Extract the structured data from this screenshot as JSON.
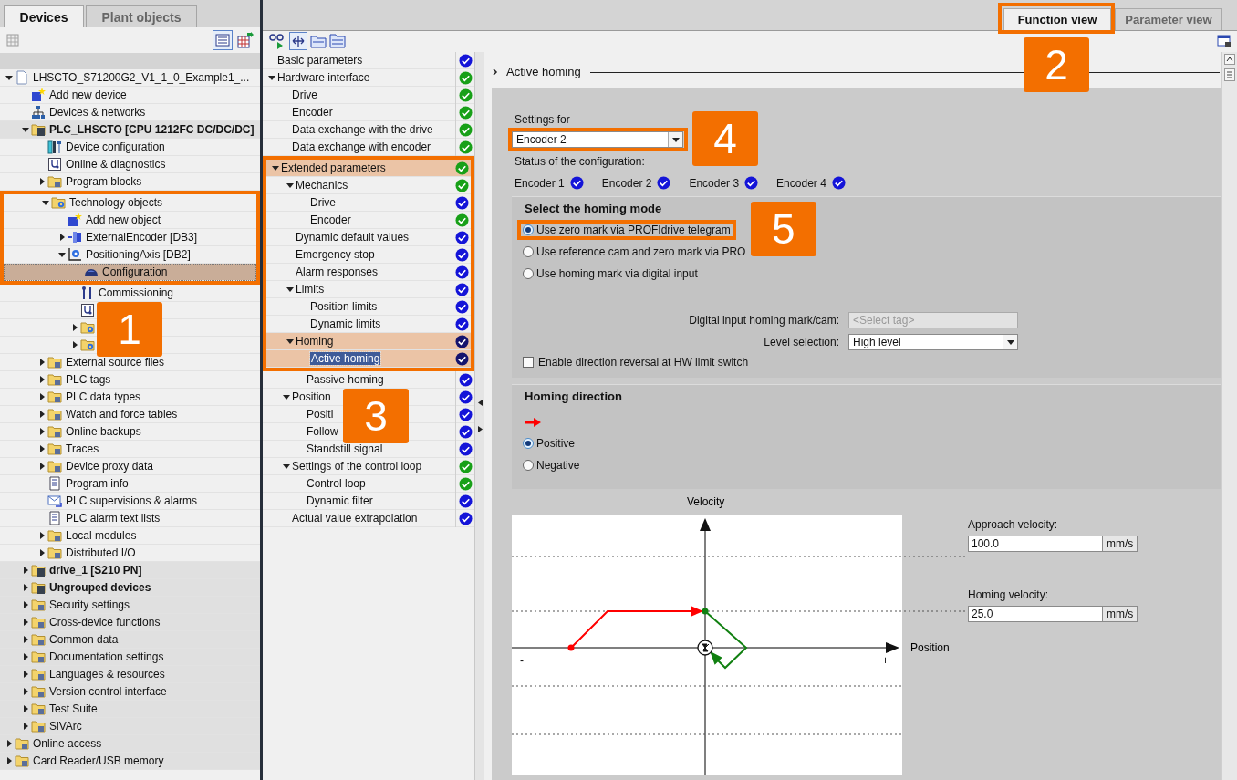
{
  "project_tree": {
    "tabs": [
      {
        "label": "Devices",
        "selected": true
      },
      {
        "label": "Plant objects",
        "selected": false
      }
    ],
    "callout": "1",
    "items": [
      {
        "label": "LHSCTO_S71200G2_V1_1_0_Example1_...",
        "kind": "project",
        "expanded": true,
        "selected": false,
        "children": [
          {
            "label": "Add new device",
            "kind": "add",
            "selected": false
          },
          {
            "label": "Devices & networks",
            "kind": "network",
            "selected": false
          },
          {
            "label": "PLC_LHSCTO [CPU 1212FC DC/DC/DC]",
            "kind": "device",
            "expanded": true,
            "selected": false,
            "children": [
              {
                "label": "Device configuration",
                "kind": "devconf",
                "selected": false
              },
              {
                "label": "Online & diagnostics",
                "kind": "diag",
                "selected": false
              },
              {
                "label": "Program blocks",
                "kind": "folder",
                "expanded": false,
                "selected": false
              },
              {
                "label": "Technology objects",
                "kind": "tech",
                "expanded": true,
                "selected": false,
                "framed": true,
                "children": [
                  {
                    "label": "Add new object",
                    "kind": "add",
                    "selected": false,
                    "framed": true
                  },
                  {
                    "label": "ExternalEncoder [DB3]",
                    "kind": "encoder",
                    "expanded": false,
                    "selected": false,
                    "framed": true
                  },
                  {
                    "label": "PositioningAxis [DB2]",
                    "kind": "axis",
                    "expanded": true,
                    "selected": false,
                    "framed": true,
                    "children": [
                      {
                        "label": "Configuration",
                        "kind": "config",
                        "selected": true,
                        "framed": true
                      },
                      {
                        "label": "Commissioning",
                        "kind": "tool",
                        "selected": false
                      },
                      {
                        "kind": "diag",
                        "selected": false
                      },
                      {
                        "kind": "tech",
                        "expanded": false,
                        "selected": false
                      },
                      {
                        "kind": "tech",
                        "expanded": false,
                        "selected": false
                      }
                    ]
                  }
                ]
              },
              {
                "label": "External source files",
                "kind": "folder",
                "expanded": false,
                "selected": false
              },
              {
                "label": "PLC tags",
                "kind": "folder",
                "expanded": false,
                "selected": false
              },
              {
                "label": "PLC data types",
                "kind": "folder",
                "expanded": false,
                "selected": false
              },
              {
                "label": "Watch and force tables",
                "kind": "folder",
                "expanded": false,
                "selected": false
              },
              {
                "label": "Online backups",
                "kind": "folder",
                "expanded": false,
                "selected": false
              },
              {
                "label": "Traces",
                "kind": "folder",
                "expanded": false,
                "selected": false
              },
              {
                "label": "Device proxy data",
                "kind": "folder",
                "expanded": false,
                "selected": false
              },
              {
                "label": "Program info",
                "kind": "leaf",
                "selected": false
              },
              {
                "label": "PLC supervisions & alarms",
                "kind": "mail",
                "selected": false
              },
              {
                "label": "PLC alarm text lists",
                "kind": "leaf",
                "selected": false
              },
              {
                "label": "Local modules",
                "kind": "folder",
                "expanded": false,
                "selected": false
              },
              {
                "label": "Distributed I/O",
                "kind": "folder",
                "expanded": false,
                "selected": false
              }
            ]
          },
          {
            "label": "drive_1 [S210 PN]",
            "kind": "device",
            "expanded": false,
            "selected": false
          },
          {
            "label": "Ungrouped devices",
            "kind": "device",
            "expanded": false,
            "selected": false
          },
          {
            "label": "Security settings",
            "kind": "folder",
            "expanded": false,
            "selected": false
          },
          {
            "label": "Cross-device functions",
            "kind": "folder",
            "expanded": false,
            "selected": false
          },
          {
            "label": "Common data",
            "kind": "folder",
            "expanded": false,
            "selected": false
          },
          {
            "label": "Documentation settings",
            "kind": "folder",
            "expanded": false,
            "selected": false
          },
          {
            "label": "Languages & resources",
            "kind": "folder",
            "expanded": false,
            "selected": false
          },
          {
            "label": "Version control interface",
            "kind": "folder",
            "expanded": false,
            "selected": false
          },
          {
            "label": "Test Suite",
            "kind": "folder",
            "expanded": false,
            "selected": false
          },
          {
            "label": "SiVArc",
            "kind": "folder",
            "expanded": false,
            "selected": false
          }
        ]
      },
      {
        "label": "Online access",
        "kind": "folder",
        "expanded": false,
        "selected": false
      },
      {
        "label": "Card Reader/USB memory",
        "kind": "folder",
        "expanded": false,
        "selected": false
      }
    ]
  },
  "view_tabs": {
    "callout": "2",
    "tabs": [
      {
        "label": "Function view",
        "selected": true,
        "framed": true
      },
      {
        "label": "Parameter view",
        "selected": false,
        "framed": false
      }
    ]
  },
  "navigation": {
    "callout": "3",
    "items": [
      {
        "label": "Basic parameters",
        "color": "#1414d8",
        "selected": false
      },
      {
        "label": "Hardware interface",
        "color": "#18a018",
        "expanded": true,
        "selected": false,
        "children": [
          {
            "label": "Drive",
            "color": "#18a018",
            "selected": false
          },
          {
            "label": "Encoder",
            "color": "#18a018",
            "selected": false
          },
          {
            "label": "Data exchange with the drive",
            "color": "#18a018",
            "selected": false
          },
          {
            "label": "Data exchange with encoder",
            "color": "#18a018",
            "selected": false
          }
        ]
      },
      {
        "label": "Extended parameters",
        "color": "#18a018",
        "expanded": true,
        "selected": false,
        "framed": true,
        "children": [
          {
            "label": "Mechanics",
            "color": "#18a018",
            "expanded": true,
            "selected": false,
            "framed": true,
            "children": [
              {
                "label": "Drive",
                "color": "#1414d8",
                "selected": false,
                "framed": true
              },
              {
                "label": "Encoder",
                "color": "#18a018",
                "selected": false,
                "framed": true
              }
            ]
          },
          {
            "label": "Dynamic default values",
            "color": "#1414d8",
            "selected": false,
            "framed": true
          },
          {
            "label": "Emergency stop",
            "color": "#1414d8",
            "selected": false,
            "framed": true
          },
          {
            "label": "Alarm responses",
            "color": "#1414d8",
            "selected": false,
            "framed": true
          },
          {
            "label": "Limits",
            "color": "#1414d8",
            "expanded": true,
            "selected": false,
            "framed": true,
            "children": [
              {
                "label": "Position limits",
                "color": "#1414d8",
                "selected": false,
                "framed": true
              },
              {
                "label": "Dynamic limits",
                "color": "#1414d8",
                "selected": false,
                "framed": true
              }
            ]
          },
          {
            "label": "Homing",
            "color": "#14146e",
            "expanded": true,
            "selected": false,
            "framed": true,
            "children": [
              {
                "label": "Active homing",
                "color": "#14146e",
                "selected": true,
                "framed": true
              },
              {
                "label": "Passive homing",
                "color": "#1414d8",
                "selected": false
              }
            ]
          },
          {
            "label": "Position",
            "color": "#1414d8",
            "expanded": true,
            "selected": false,
            "children": [
              {
                "label": "Positi",
                "color": "#1414d8",
                "selected": false
              },
              {
                "label": "Follow",
                "color": "#1414d8",
                "selected": false
              },
              {
                "label": "Standstill signal",
                "color": "#1414d8",
                "selected": false
              }
            ]
          },
          {
            "label": "Settings of the control loop",
            "color": "#18a018",
            "expanded": true,
            "selected": false,
            "children": [
              {
                "label": "Control loop",
                "color": "#18a018",
                "selected": false
              },
              {
                "label": "Dynamic filter",
                "color": "#1414d8",
                "selected": false
              }
            ]
          },
          {
            "label": "Actual value extrapolation",
            "color": "#1414d8",
            "selected": false
          }
        ]
      }
    ]
  },
  "page_title": "Active homing",
  "settings_for": {
    "label": "Settings for",
    "value": "Encoder 2",
    "framed": true,
    "callout": "4"
  },
  "configuration_status": {
    "label": "Status of the configuration:",
    "encoders": [
      {
        "label": "Encoder 1",
        "color": "#1414d8"
      },
      {
        "label": "Encoder 2",
        "color": "#1414d8"
      },
      {
        "label": "Encoder 3",
        "color": "#1414d8"
      },
      {
        "label": "Encoder 4",
        "color": "#1414d8"
      }
    ]
  },
  "homing_mode": {
    "title": "Select the homing mode",
    "options": [
      {
        "label": "Use zero mark via PROFIdrive telegram",
        "selected": true,
        "framed": true,
        "callout": "5"
      },
      {
        "label": "Use reference cam and zero mark via PRO",
        "selected": false,
        "framed": false
      },
      {
        "label": "Use homing mark via digital input",
        "selected": false,
        "framed": false
      }
    ],
    "digital_input": {
      "label": "Digital input homing mark/cam:",
      "placeholder": "<Select tag>",
      "disabled": true
    },
    "level_selection": {
      "label": "Level selection:",
      "value": "High level"
    },
    "direction_reversal": {
      "label": "Enable direction reversal at HW limit switch",
      "checked": false
    }
  },
  "homing_direction": {
    "title": "Homing direction",
    "options": [
      {
        "label": "Positive",
        "selected": true
      },
      {
        "label": "Negative",
        "selected": false
      }
    ]
  },
  "diagram": {
    "y_axis": "Velocity",
    "x_axis": "Position",
    "minus": "-",
    "plus": "+",
    "approach_velocity": {
      "label": "Approach velocity:",
      "value": "100.0",
      "unit": "mm/s"
    },
    "homing_velocity": {
      "label": "Homing velocity:",
      "value": "25.0",
      "unit": "mm/s"
    }
  }
}
